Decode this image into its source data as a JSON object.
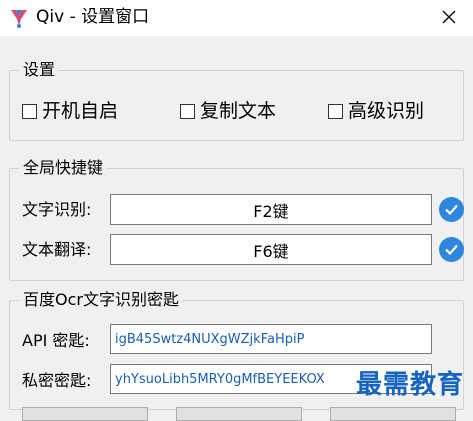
{
  "window": {
    "title": "Qiv - 设置窗口",
    "close_icon": "×"
  },
  "settings": {
    "legend": "设置",
    "options": [
      {
        "label": "开机自启",
        "checked": false
      },
      {
        "label": "复制文本",
        "checked": false
      },
      {
        "label": "高级识别",
        "checked": false
      }
    ]
  },
  "hotkeys": {
    "legend": "全局快捷键",
    "rows": [
      {
        "label": "文字识别:",
        "value": "F2键",
        "icon": "check-icon"
      },
      {
        "label": "文本翻译:",
        "value": "F6键",
        "icon": "check-icon"
      }
    ]
  },
  "ocr": {
    "legend": "百度Ocr文字识别密匙",
    "api_key_label": "API 密匙:",
    "api_key_value": "igB45Swtz4NUXgWZjkFaHpiP",
    "secret_key_label": "私密密匙:",
    "secret_key_value": "yhYsuoLibh5MRY0gMfBEYEEKOX"
  },
  "watermark": "最需教育",
  "colors": {
    "accent": "#2e86de",
    "input_text": "#1a5fb4",
    "watermark": "#1565c0"
  }
}
